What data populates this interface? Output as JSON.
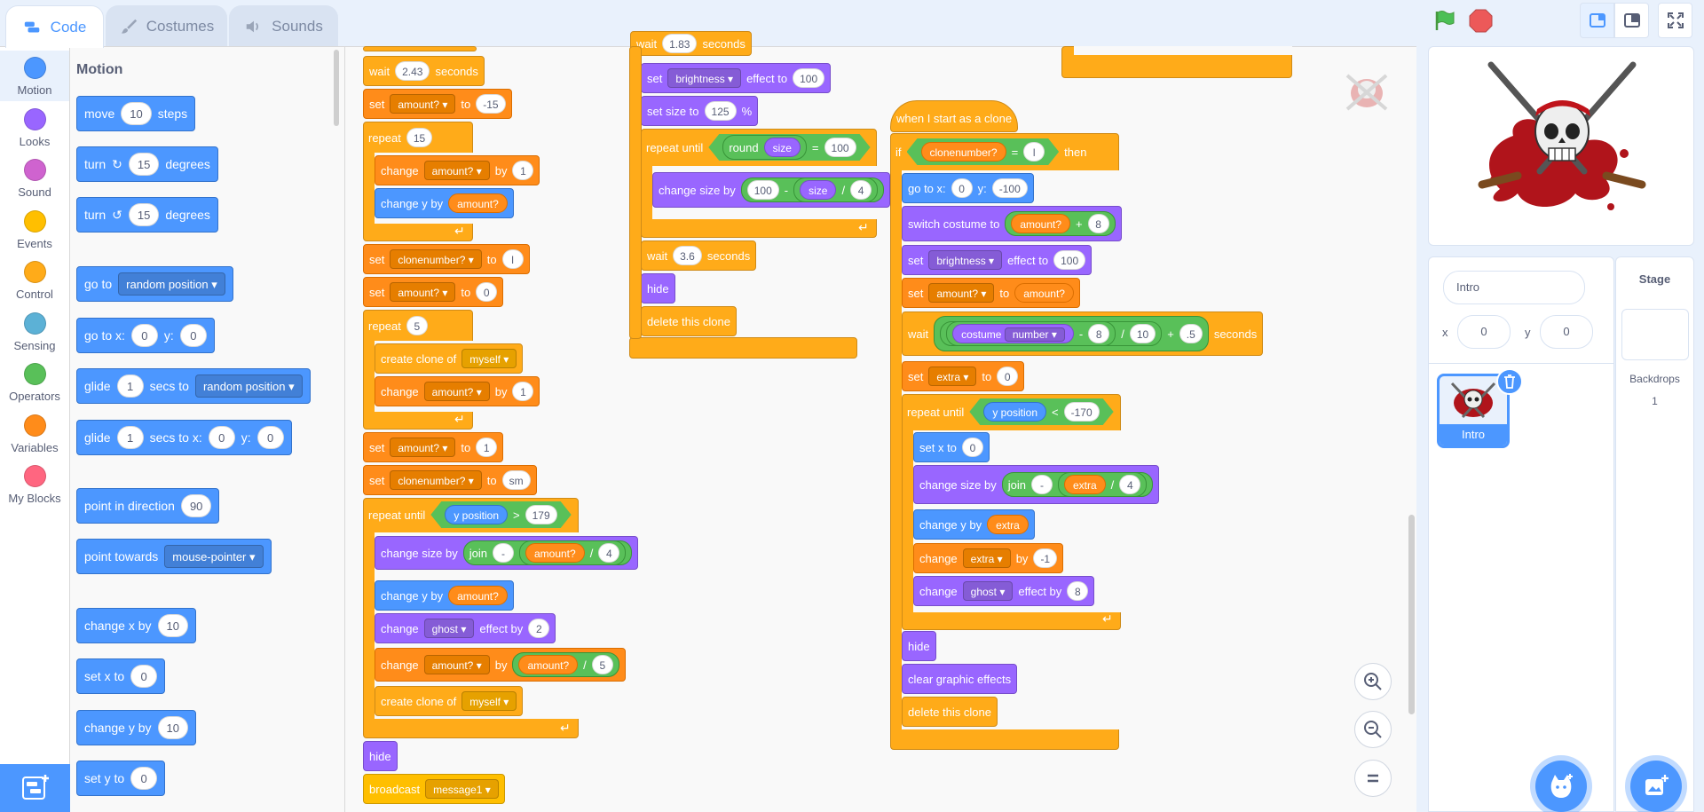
{
  "tabs": {
    "code": "Code",
    "costumes": "Costumes",
    "sounds": "Sounds"
  },
  "categories": [
    {
      "label": "Motion",
      "color": "#4c97ff"
    },
    {
      "label": "Looks",
      "color": "#9966ff"
    },
    {
      "label": "Sound",
      "color": "#cf63cf"
    },
    {
      "label": "Events",
      "color": "#ffbf00"
    },
    {
      "label": "Control",
      "color": "#ffab19"
    },
    {
      "label": "Sensing",
      "color": "#5cb1d6"
    },
    {
      "label": "Operators",
      "color": "#59c059"
    },
    {
      "label": "Variables",
      "color": "#ff8c1a"
    },
    {
      "label": "My Blocks",
      "color": "#ff6680"
    }
  ],
  "palette": {
    "title": "Motion",
    "move": {
      "a": "move",
      "n": "10",
      "b": "steps"
    },
    "turn_right": {
      "a": "turn",
      "n": "15",
      "b": "degrees"
    },
    "turn_left": {
      "a": "turn",
      "n": "15",
      "b": "degrees"
    },
    "goto": {
      "a": "go to",
      "d": "random position"
    },
    "gotoxy": {
      "a": "go to x:",
      "x": "0",
      "yl": "y:",
      "y": "0"
    },
    "glide_to": {
      "a": "glide",
      "n": "1",
      "b": "secs to",
      "d": "random position"
    },
    "glide_xy": {
      "a": "glide",
      "n": "1",
      "b": "secs to x:",
      "x": "0",
      "yl": "y:",
      "y": "0"
    },
    "point_dir": {
      "a": "point in direction",
      "n": "90"
    },
    "point_towards": {
      "a": "point towards",
      "d": "mouse-pointer"
    },
    "change_x": {
      "a": "change x by",
      "n": "10"
    },
    "set_x": {
      "a": "set x to",
      "n": "0"
    },
    "change_y": {
      "a": "change y by",
      "n": "10"
    },
    "set_y": {
      "a": "set y to",
      "n": "0"
    }
  },
  "script1": {
    "wait": {
      "a": "wait",
      "n": "2.43",
      "b": "seconds"
    },
    "set1": {
      "a": "set",
      "d": "amount?",
      "b": "to",
      "n": "-15"
    },
    "repeat1": {
      "a": "repeat",
      "n": "15"
    },
    "change1": {
      "a": "change",
      "d": "amount?",
      "b": "by",
      "n": "1"
    },
    "changey1": {
      "a": "change y by",
      "r": "amount?"
    },
    "set2": {
      "a": "set",
      "d": "clonenumber?",
      "b": "to",
      "n": "l"
    },
    "set3": {
      "a": "set",
      "d": "amount?",
      "b": "to",
      "n": "0"
    },
    "repeat2": {
      "a": "repeat",
      "n": "5"
    },
    "clone1": {
      "a": "create clone of",
      "d": "myself"
    },
    "change2": {
      "a": "change",
      "d": "amount?",
      "b": "by",
      "n": "1"
    },
    "set4": {
      "a": "set",
      "d": "amount?",
      "b": "to",
      "n": "1"
    },
    "set5": {
      "a": "set",
      "d": "clonenumber?",
      "b": "to",
      "n": "sm"
    },
    "until": {
      "a": "repeat until",
      "r": "y position",
      "op": ">",
      "n": "179"
    },
    "size1": {
      "a": "change size by",
      "j": "join",
      "n1": "-",
      "r": "amount?",
      "op": "/",
      "n2": "4"
    },
    "changey2": {
      "a": "change y by",
      "r": "amount?"
    },
    "ghost": {
      "a": "change",
      "d": "ghost",
      "b": "effect by",
      "n": "2"
    },
    "change3": {
      "a": "change",
      "d": "amount?",
      "b": "by",
      "r": "amount?",
      "op": "/",
      "n": "5"
    },
    "clone2": {
      "a": "create clone of",
      "d": "myself"
    },
    "hide": "hide",
    "broadcast": {
      "a": "broadcast",
      "d": "message1"
    }
  },
  "script2": {
    "wait0": {
      "a": "wait",
      "n": "1.83",
      "b": "seconds"
    },
    "bright": {
      "a": "set",
      "d": "brightness",
      "b": "effect to",
      "n": "100"
    },
    "size": {
      "a": "set size to",
      "n": "125",
      "b": "%"
    },
    "until": {
      "a": "repeat until",
      "f": "round",
      "r": "size",
      "op": "=",
      "n": "100"
    },
    "csize": {
      "a": "change size by",
      "n1": "100",
      "op1": "-",
      "r": "size",
      "op2": "/",
      "n2": "4"
    },
    "wait": {
      "a": "wait",
      "n": "3.6",
      "b": "seconds"
    },
    "hide": "hide",
    "del": "delete this clone"
  },
  "script3": {
    "hat": "when I start as a clone",
    "if": {
      "a": "if",
      "d": "clonenumber?",
      "op": "=",
      "n": "l",
      "b": "then"
    },
    "goto": {
      "a": "go to x:",
      "x": "0",
      "yl": "y:",
      "y": "-100"
    },
    "costume": {
      "a": "switch costume to",
      "r": "amount?",
      "op": "+",
      "n": "8"
    },
    "bright": {
      "a": "set",
      "d": "brightness",
      "b": "effect to",
      "n": "100"
    },
    "setamt": {
      "a": "set",
      "d": "amount?",
      "b": "to",
      "r": "amount?"
    },
    "wait": {
      "a": "wait",
      "r1": "costume",
      "d": "number",
      "op1": "-",
      "n1": "8",
      "op2": "/",
      "n2": "10",
      "op3": "+",
      "n3": ".5",
      "b": "seconds"
    },
    "setextra": {
      "a": "set",
      "d": "extra",
      "b": "to",
      "n": "0"
    },
    "until": {
      "a": "repeat until",
      "r": "y position",
      "op": "<",
      "n": "-170"
    },
    "setx": {
      "a": "set x to",
      "n": "0"
    },
    "csize": {
      "a": "change size by",
      "j": "join",
      "n1": "-",
      "r": "extra",
      "op": "/",
      "n2": "4"
    },
    "cy": {
      "a": "change y by",
      "r": "extra"
    },
    "cextra": {
      "a": "change",
      "d": "extra",
      "b": "by",
      "n": "-1"
    },
    "ghost": {
      "a": "change",
      "d": "ghost",
      "b": "effect by",
      "n": "8"
    },
    "hide": "hide",
    "clear": "clear graphic effects",
    "del": "delete this clone"
  },
  "sprite": {
    "name": "Intro",
    "x_label": "x",
    "x": "0",
    "y_label": "y",
    "y": "0",
    "thumb_label": "Intro"
  },
  "stage": {
    "title": "Stage",
    "backdrops_label": "Backdrops",
    "backdrops_count": "1"
  }
}
